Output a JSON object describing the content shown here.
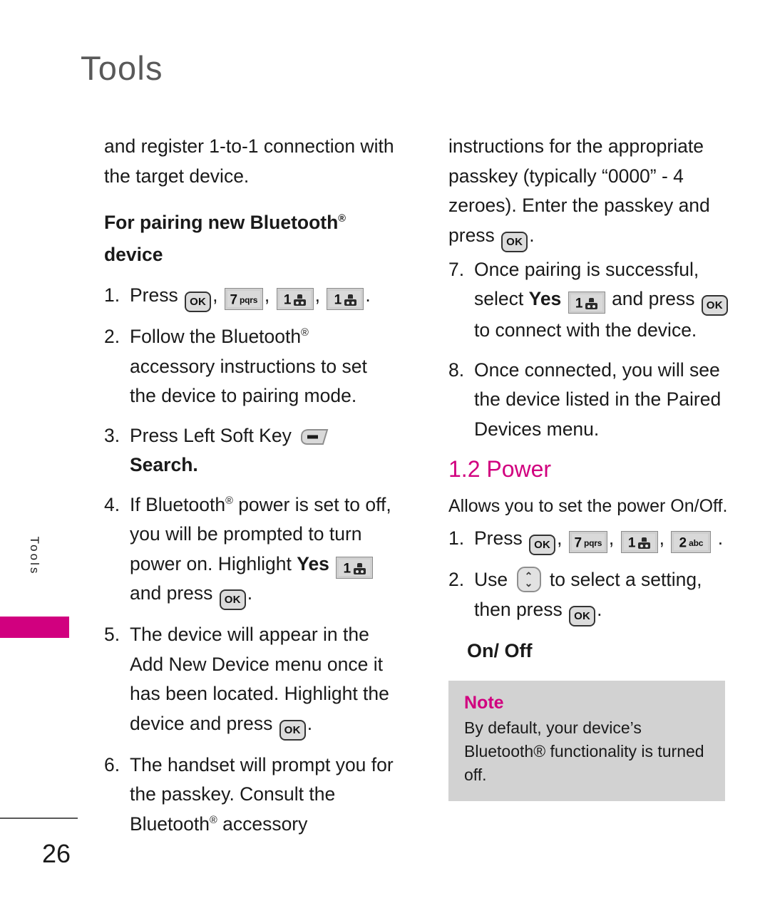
{
  "page": {
    "chapter_title": "Tools",
    "side_tab_label": "Tools",
    "page_number": "26",
    "accent_color": "#d1007f"
  },
  "left_column": {
    "continuation_text": "and register 1-to-1 connection with the target device.",
    "subheading": "For pairing new Bluetooth",
    "subheading_line2": "device",
    "steps": [
      {
        "num": "1.",
        "lead": "Press",
        "keys": [
          "OK",
          "7 pqrs",
          "1 voicemail",
          "1 voicemail"
        ],
        "trailing": "."
      },
      {
        "num": "2.",
        "text_a": "Follow the Bluetooth",
        "text_b": "accessory instructions to set the device to pairing mode."
      },
      {
        "num": "3.",
        "text_a": "Press Left Soft Key",
        "key": "left-soft-key",
        "bold_tail": "Search."
      },
      {
        "num": "4.",
        "text_a": "If Bluetooth",
        "text_b": "power is set to off, you will be prompted to turn power on. Highlight",
        "bold_word": "Yes",
        "key": "1 voicemail",
        "text_c": "and press",
        "key2": "OK",
        "trailing": "."
      },
      {
        "num": "5.",
        "text_a": "The device will appear in the Add New Device menu once it has been located. Highlight the device and press",
        "key": "OK",
        "trailing": "."
      },
      {
        "num": "6.",
        "text_a": "The handset will prompt you for the passkey. Consult the Bluetooth",
        "text_b": "accessory"
      }
    ]
  },
  "right_column": {
    "continuation_text_a": "instructions for the appropriate passkey (typically “0000” - 4 zeroes). Enter the passkey and press",
    "continuation_key": "OK",
    "continuation_trailing": ".",
    "steps": [
      {
        "num": "7.",
        "text_a": "Once pairing is successful, select",
        "bold_word": "Yes",
        "key": "1 voicemail",
        "text_b": "and press",
        "key2": "OK",
        "text_c": "to connect with the device."
      },
      {
        "num": "8.",
        "text_a": "Once connected, you will see the device listed in the Paired Devices menu."
      }
    ],
    "section_heading": "1.2 Power",
    "section_description": "Allows you to set the power On/Off.",
    "power_steps": [
      {
        "num": "1.",
        "lead": "Press",
        "keys": [
          "OK",
          "7 pqrs",
          "1 voicemail",
          "2 abc"
        ],
        "trailing": "."
      },
      {
        "num": "2.",
        "lead": "Use",
        "key": "nav-up-down",
        "text_a": "to select a setting, then press",
        "key2": "OK",
        "trailing": "."
      }
    ],
    "options_heading": "On/ Off",
    "note": {
      "title": "Note",
      "body": "By default, your device’s Bluetooth® functionality is turned off."
    }
  },
  "keys": {
    "ok_label": "OK",
    "seven_digit": "7",
    "seven_letters": "pqrs",
    "one_digit": "1",
    "two_digit": "2",
    "two_letters": "abc",
    "nav_up": "⌃",
    "nav_down": "⌄"
  }
}
